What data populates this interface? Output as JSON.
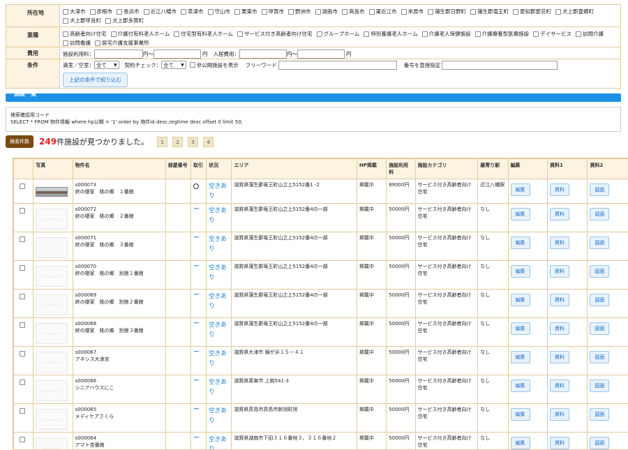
{
  "form": {
    "location": {
      "label": "所在地",
      "options": [
        "大津市",
        "彦根市",
        "長浜市",
        "近江八幡市",
        "草津市",
        "守山市",
        "栗東市",
        "甲賀市",
        "野洲市",
        "湖南市",
        "高島市",
        "東近江市",
        "米原市",
        "蒲生郡日野町",
        "蒲生郡竜王町",
        "愛知郡愛荘町",
        "犬上郡豊郷町",
        "犬上郡甲良町",
        "犬上郡多賀町"
      ]
    },
    "business": {
      "label": "業種",
      "options": [
        "高齢者向け住宅",
        "介護付有料老人ホーム",
        "住宅型有料老人ホーム",
        "サービス付き高齢者向け住宅",
        "グループホーム",
        "特別養護老人ホーム",
        "介護老人保健施設",
        "介護療養型医療施設",
        "デイサービス",
        "訪問介護",
        "訪問看護",
        "居宅介護支援事業所"
      ]
    },
    "fee": {
      "label": "費用",
      "usage_label": "施設利用料：",
      "yen_tilde": "円～",
      "yen": "円",
      "entry_label": "入居費用："
    },
    "conditions": {
      "label": "条件",
      "vacancy_label": "満室／空室：",
      "vacancy_value": "全て",
      "contract_label": "契約チェック：",
      "contract_value": "全て",
      "private_label": "非公開施設を表示",
      "freeword_label": "フリーワード",
      "number_label": "番号を直接指定",
      "filter_button": "上記の条件で絞り込む"
    }
  },
  "section_bar": "施設一覧",
  "sql": {
    "title": "検索確認用コード",
    "query": "SELECT * FROM 物件情報 where hp公開 = '1' order by 物件id desc,regtime desc offset 0 limit 50;"
  },
  "result": {
    "count_button": "検索件数",
    "count": "249",
    "text": "件施設が見つかりました。",
    "pages": [
      "1",
      "2",
      "3",
      "4"
    ]
  },
  "table": {
    "headers": [
      "",
      "写真",
      "物件名",
      "部屋番号",
      "取引",
      "状況",
      "エリア",
      "HP掲載",
      "施設利用料",
      "施設カテゴリ",
      "最寄り駅",
      "編集",
      "資料1",
      "資料2"
    ],
    "edit_label": "編集",
    "doc_label": "資料",
    "map_label": "図面",
    "rows": [
      {
        "id": "s000073",
        "name": "終の棲家　桃の郷　１番館",
        "deal": "○",
        "status": "空きあり",
        "area": "滋賀県蒲生郡竜王町山之上5152番1 -2",
        "hp": "掲載中",
        "fee": "89000円",
        "category": "サービス付き高齢者向け住宅",
        "station": "近江八幡駅"
      },
      {
        "id": "s000072",
        "name": "終の棲家　桃の郷　２番館",
        "deal": "－",
        "status": "空きあり",
        "area": "滋賀県蒲生郡竜王町山之上5152番4の一部",
        "hp": "掲載中",
        "fee": "50000円",
        "category": "サービス付き高齢者向け住宅",
        "station": "なし"
      },
      {
        "id": "s000071",
        "name": "終の棲家　桃の郷　３番館",
        "deal": "－",
        "status": "空きあり",
        "area": "滋賀県蒲生郡竜王町山之上5152番4の一部",
        "hp": "掲載中",
        "fee": "50000円",
        "category": "サービス付き高齢者向け住宅",
        "station": "なし"
      },
      {
        "id": "s000070",
        "name": "終の棲家　桃の郷　別館１番館",
        "deal": "－",
        "status": "空きあり",
        "area": "滋賀県蒲生郡竜王町山之上5152番4の一部",
        "hp": "掲載中",
        "fee": "50000円",
        "category": "サービス付き高齢者向け住宅",
        "station": "なし"
      },
      {
        "id": "s000069",
        "name": "終の棲家　桃の郷　別館２番館",
        "deal": "－",
        "status": "空きあり",
        "area": "滋賀県蒲生郡竜王町山之上5152番4の一部",
        "hp": "掲載中",
        "fee": "50000円",
        "category": "サービス付き高齢者向け住宅",
        "station": "なし"
      },
      {
        "id": "s000068",
        "name": "終の棲家　桃の郷　別館３番館",
        "deal": "－",
        "status": "空きあり",
        "area": "滋賀県蒲生郡竜王町山之上5152番4の一部",
        "hp": "掲載中",
        "fee": "50000円",
        "category": "サービス付き高齢者向け住宅",
        "station": "なし"
      },
      {
        "id": "s000067",
        "name": "アネシス大津京",
        "deal": "－",
        "status": "空きあり",
        "area": "滋賀県大津市 錦が浜１５－４１",
        "hp": "掲載中",
        "fee": "50000円",
        "category": "サービス付き高齢者向け住宅",
        "station": "なし"
      },
      {
        "id": "s000066",
        "name": "シニアハウスにこ",
        "deal": "－",
        "status": "空きあり",
        "area": "滋賀県栗東市 上鈎541-3",
        "hp": "掲載中",
        "fee": "50000円",
        "category": "サービス付き高齢者向け住宅",
        "station": "なし"
      },
      {
        "id": "s000065",
        "name": "メディケアさくら",
        "deal": "－",
        "status": "空きあり",
        "area": "滋賀県高島市高島市新旭町旭",
        "hp": "掲載中",
        "fee": "50000円",
        "category": "サービス付き高齢者向け住宅",
        "station": "なし"
      },
      {
        "id": "s000064",
        "name": "アマト杏番館",
        "deal": "－",
        "status": "空きあり",
        "area": "滋賀県湖南市下田３１６番地３、３１６番地２",
        "hp": "掲載中",
        "fee": "50000円",
        "category": "サービス付き高齢者向け住宅",
        "station": "なし"
      }
    ]
  }
}
